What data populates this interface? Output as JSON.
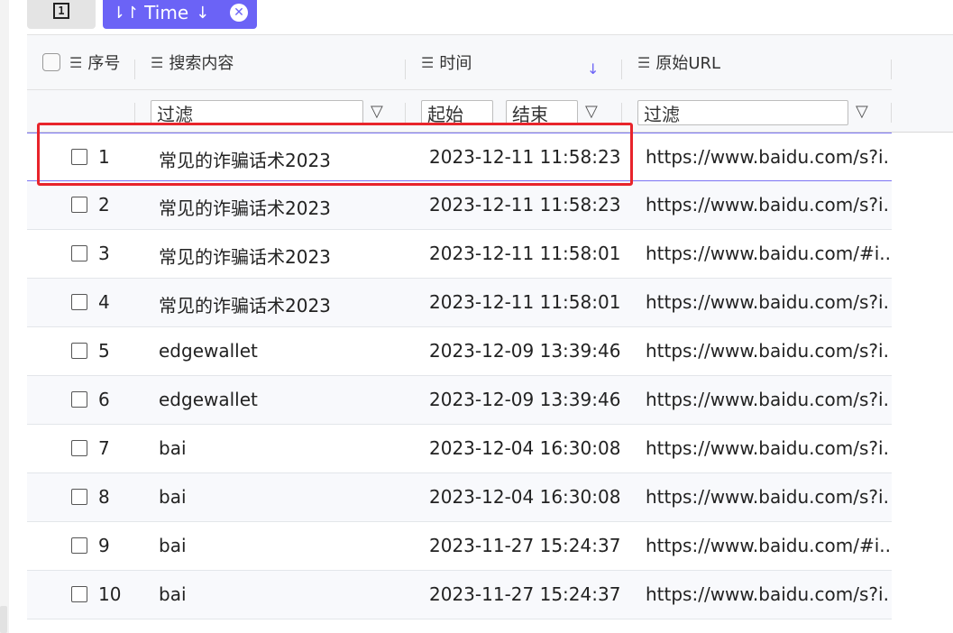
{
  "toolbar": {
    "square_button_glyph": "1",
    "sort_chip": {
      "sort_glyph": "⇂↾",
      "label": "Time",
      "direction": "↓",
      "close_glyph": "✕",
      "color": "#6b63f6"
    }
  },
  "table": {
    "headers": {
      "index": "序号",
      "query": "搜索内容",
      "time": "时间",
      "url": "原始URL",
      "time_sort_arrow": "↓"
    },
    "filters": {
      "query_placeholder": "过滤",
      "time_start": "起始",
      "time_end": "结束",
      "url_placeholder": "过滤"
    },
    "rows": [
      {
        "index": "1",
        "query": "常见的诈骗话术2023",
        "time": "2023-12-11 11:58:23",
        "url": "https://www.baidu.com/s?i..."
      },
      {
        "index": "2",
        "query": "常见的诈骗话术2023",
        "time": "2023-12-11 11:58:23",
        "url": "https://www.baidu.com/s?i..."
      },
      {
        "index": "3",
        "query": "常见的诈骗话术2023",
        "time": "2023-12-11 11:58:01",
        "url": "https://www.baidu.com/#i..."
      },
      {
        "index": "4",
        "query": "常见的诈骗话术2023",
        "time": "2023-12-11 11:58:01",
        "url": "https://www.baidu.com/s?i..."
      },
      {
        "index": "5",
        "query": "edgewallet",
        "time": "2023-12-09 13:39:46",
        "url": "https://www.baidu.com/s?i..."
      },
      {
        "index": "6",
        "query": "edgewallet",
        "time": "2023-12-09 13:39:46",
        "url": "https://www.baidu.com/s?i..."
      },
      {
        "index": "7",
        "query": "bai",
        "time": "2023-12-04 16:30:08",
        "url": "https://www.baidu.com/s?i..."
      },
      {
        "index": "8",
        "query": "bai",
        "time": "2023-12-04 16:30:08",
        "url": "https://www.baidu.com/s?i..."
      },
      {
        "index": "9",
        "query": "bai",
        "time": "2023-11-27 15:24:37",
        "url": "https://www.baidu.com/#i..."
      },
      {
        "index": "10",
        "query": "bai",
        "time": "2023-11-27 15:24:37",
        "url": "https://www.baidu.com/s?i..."
      }
    ],
    "selected_row_index": "1",
    "highlight_color": "#e8242b"
  }
}
